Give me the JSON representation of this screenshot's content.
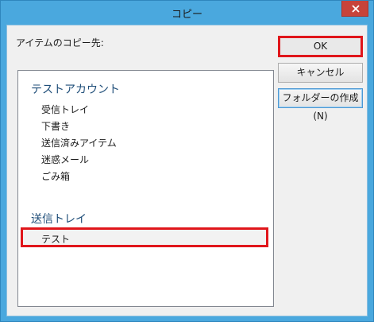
{
  "window": {
    "title": "コピー"
  },
  "dialog": {
    "destination_label": "アイテムのコピー先:",
    "buttons": {
      "ok": "OK",
      "cancel": "キャンセル",
      "new_folder": "フォルダーの作成(N)"
    },
    "tree": {
      "accounts": [
        {
          "name": "テストアカウント",
          "folders": [
            "受信トレイ",
            "下書き",
            "送信済みアイテム",
            "迷惑メール",
            "ごみ箱"
          ],
          "selected_folder": "テスト"
        },
        {
          "name": "送信トレイ"
        }
      ]
    }
  },
  "colors": {
    "highlight": "#e0161b",
    "titlebar": "#4aa8de",
    "close": "#c7433a"
  },
  "icons": {
    "close": "close-icon"
  }
}
